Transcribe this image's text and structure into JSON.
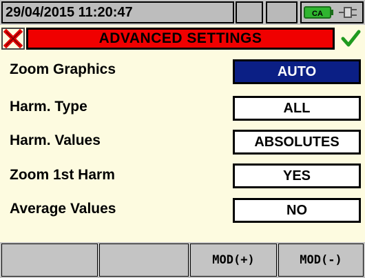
{
  "status": {
    "datetime": "29/04/2015 11:20:47",
    "battery_label": "CA"
  },
  "header": {
    "title": "ADVANCED SETTINGS",
    "close_icon": "close-x-icon",
    "confirm_icon": "checkmark-icon"
  },
  "settings": [
    {
      "label": "Zoom Graphics",
      "value": "AUTO",
      "selected": true
    },
    {
      "label": "Harm. Type",
      "value": "ALL",
      "selected": false
    },
    {
      "label": "Harm. Values",
      "value": "ABSOLUTES",
      "selected": false
    },
    {
      "label": "Zoom 1st Harm",
      "value": "YES",
      "selected": false
    },
    {
      "label": "Average Values",
      "value": "NO",
      "selected": false
    }
  ],
  "function_keys": {
    "f1": "",
    "f2": "",
    "f3": "MOD(+)",
    "f4": "MOD(-)"
  },
  "colors": {
    "title_bg": "#f00000",
    "selected_bg": "#0b1f85",
    "page_bg": "#fdfbe0",
    "battery_green": "#2fb52f"
  }
}
